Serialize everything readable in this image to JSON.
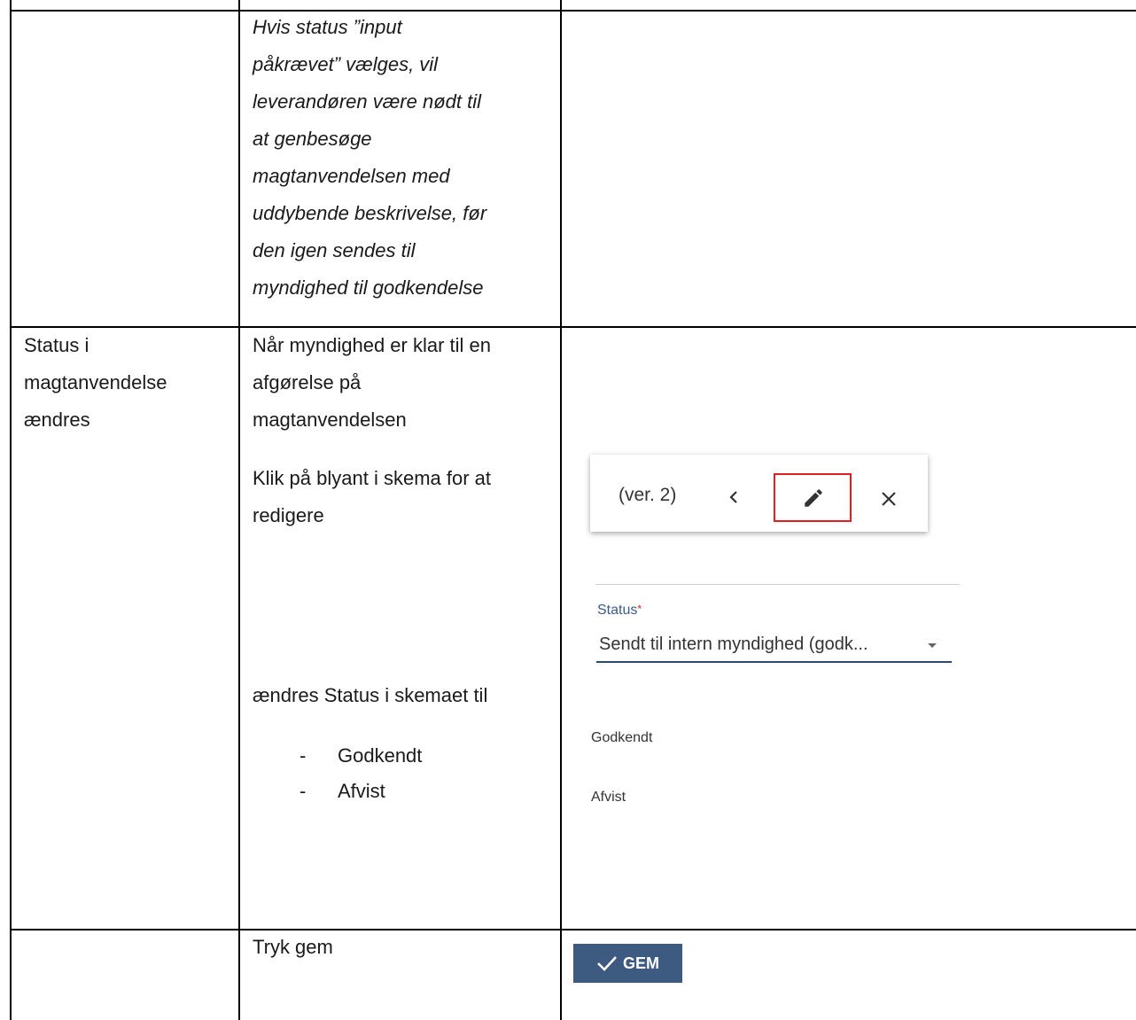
{
  "row1": {
    "col2_lines": [
      "Hvis status ”input",
      "påkrævet” vælges, vil",
      "leverandøren være nødt til",
      "at genbesøge",
      "magtanvendelsen med",
      "uddybende beskrivelse, før",
      "den igen sendes til",
      "myndighed til godkendelse"
    ]
  },
  "row2": {
    "col1_lines": [
      "Status i",
      "magtanvendelse",
      "ændres"
    ],
    "col2_para1_lines": [
      "Når myndighed er klar til en",
      "afgørelse på",
      "magtanvendelsen"
    ],
    "col2_para2_lines": [
      "Klik på blyant i skema for at",
      "redigere"
    ],
    "col2_para3": "ændres Status i skemaet til",
    "col2_bullets": [
      "Godkendt",
      "Afvist"
    ],
    "toolbar": {
      "version": "(ver. 2)"
    },
    "status_field": {
      "label": "Status",
      "required_mark": "*",
      "value": "Sendt til intern myndighed (godk..."
    },
    "options": [
      "Godkendt",
      "Afvist"
    ]
  },
  "row3": {
    "col2": "Tryk gem",
    "button_label": "GEM"
  }
}
